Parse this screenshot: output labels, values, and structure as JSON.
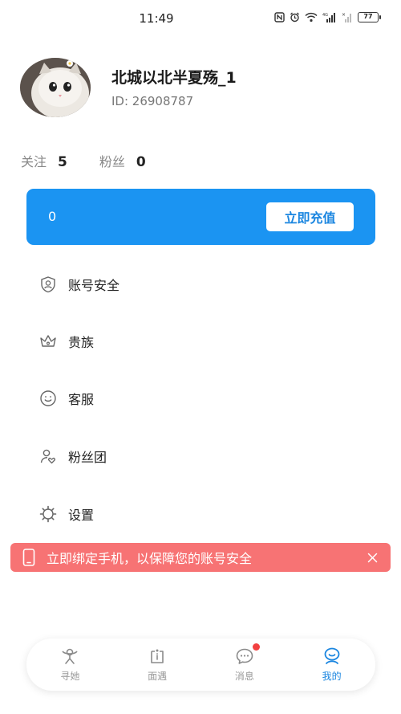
{
  "status_bar": {
    "time": "11:49",
    "battery": "77",
    "icons": [
      "nfc-icon",
      "alarm-icon",
      "wifi-icon",
      "signal-4g-icon",
      "signal-icon",
      "battery-icon"
    ]
  },
  "profile": {
    "name": "北城以北半夏殇_1",
    "id_label": "ID: ",
    "id_value": "26908787",
    "avatar": "cat-avatar"
  },
  "stats": {
    "following_label": "关注",
    "following_value": "5",
    "fans_label": "粉丝",
    "fans_value": "0"
  },
  "wallet": {
    "balance": "0",
    "recharge_label": "立即充值",
    "color": "#1b94f2"
  },
  "menu": [
    {
      "label": "账号安全",
      "icon": "shield-user-icon"
    },
    {
      "label": "贵族",
      "icon": "crown-icon"
    },
    {
      "label": "客服",
      "icon": "smile-icon"
    },
    {
      "label": "粉丝团",
      "icon": "user-heart-icon"
    },
    {
      "label": "设置",
      "icon": "gear-icon"
    }
  ],
  "banner": {
    "text": "立即绑定手机，以保障您的账号安全",
    "color": "#f77374"
  },
  "tabs": [
    {
      "label": "寻她",
      "icon": "find-icon"
    },
    {
      "label": "面遇",
      "icon": "meet-icon"
    },
    {
      "label": "消息",
      "icon": "message-icon"
    },
    {
      "label": "我的",
      "icon": "profile-icon",
      "active": true
    }
  ],
  "accent_color": "#1b86e0"
}
